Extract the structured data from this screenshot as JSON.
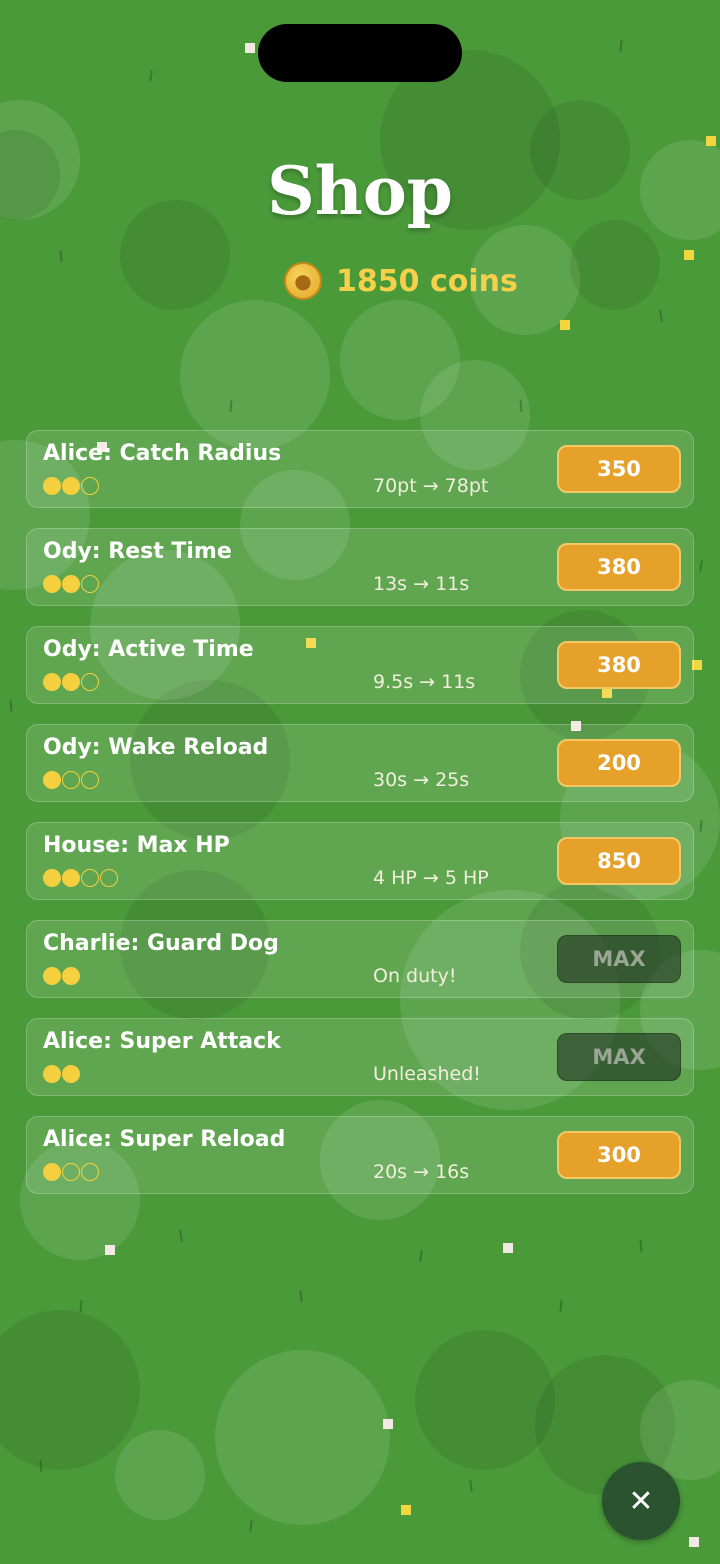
{
  "screen": {
    "title": "Shop",
    "coins_label": "1850 coins",
    "coin_icon": "paw-coin-icon",
    "close_icon": "close-icon"
  },
  "colors": {
    "grass": "#4a9a3a",
    "button": "#e6a12a",
    "max_button": "#2f4a30",
    "coin_text": "#f5d04a",
    "dot": "#f4cf3e"
  },
  "upgrades": [
    {
      "name": "Alice: Catch Radius",
      "level": 2,
      "max_level": 3,
      "effect": "70pt → 78pt",
      "button": "350",
      "maxed": false
    },
    {
      "name": "Ody: Rest Time",
      "level": 2,
      "max_level": 3,
      "effect": "13s → 11s",
      "button": "380",
      "maxed": false
    },
    {
      "name": "Ody: Active Time",
      "level": 2,
      "max_level": 3,
      "effect": "9.5s → 11s",
      "button": "380",
      "maxed": false
    },
    {
      "name": "Ody: Wake Reload",
      "level": 1,
      "max_level": 3,
      "effect": "30s → 25s",
      "button": "200",
      "maxed": false
    },
    {
      "name": "House: Max HP",
      "level": 2,
      "max_level": 4,
      "effect": "4 HP → 5 HP",
      "button": "850",
      "maxed": false
    },
    {
      "name": "Charlie: Guard Dog",
      "level": 2,
      "max_level": 2,
      "effect": "On duty!",
      "button": "MAX",
      "maxed": true
    },
    {
      "name": "Alice: Super Attack",
      "level": 2,
      "max_level": 2,
      "effect": "Unleashed!",
      "button": "MAX",
      "maxed": true
    },
    {
      "name": "Alice: Super Reload",
      "level": 1,
      "max_level": 3,
      "effect": "20s → 16s",
      "button": "300",
      "maxed": false
    }
  ]
}
